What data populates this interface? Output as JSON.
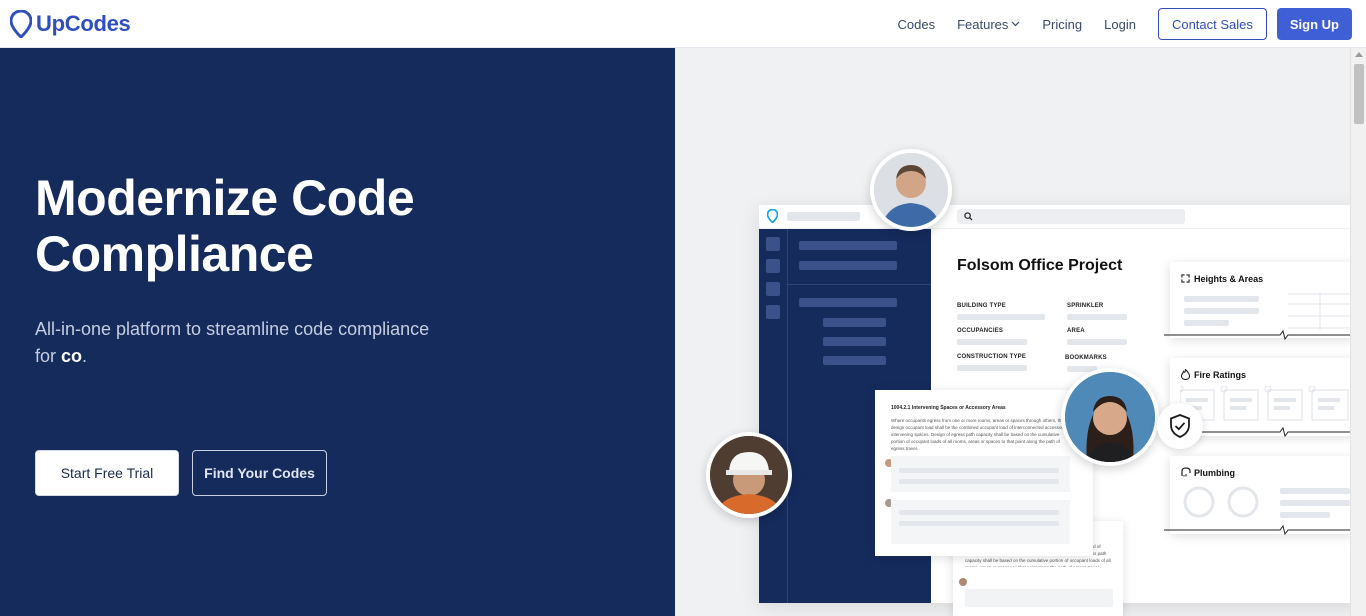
{
  "nav": {
    "brand": "UpCodes",
    "links": [
      "Codes",
      "Features",
      "Pricing",
      "Login"
    ],
    "contact_sales": "Contact Sales",
    "sign_up": "Sign Up"
  },
  "hero": {
    "title": "Modernize Code Compliance",
    "subtitle_pre": "All-in-one platform to streamline code compliance for ",
    "subtitle_emph": "co",
    "subtitle_post": ".",
    "primary_cta": "Start Free Trial",
    "secondary_cta": "Find Your Codes"
  },
  "mockup": {
    "project_title": "Folsom Office Project",
    "field_labels": [
      "BUILDING TYPE",
      "SPRINKLER",
      "OCCUPANCIES",
      "AREA",
      "CONSTRUCTION TYPE",
      "BOOKMARKS"
    ],
    "code_section_title": "1004.2.1 Intervening Spaces or Accessory Areas",
    "code_section_text": "Where occupants egress from one or more rooms, areas or spaces through others, the design occupant load shall be the combined occupant load of interconnected accessory or intervening spaces. Design of egress path capacity shall be based on the cumulative portion of occupant loads of all rooms, areas or spaces to that point along the path of egress travel.",
    "code_fragment_text": "..., the design occupant load shall be the combined occupant load of interconnected accessory or intervening spaces. Design of egress path capacity shall be based on the cumulative portion of occupant loads of all rooms, areas or spaces to that point along the path of egress travel.",
    "side_cards": [
      "Heights & Areas",
      "Fire Ratings",
      "Plumbing"
    ]
  },
  "colors": {
    "brand": "#2f4fbf",
    "hero_bg": "#152b5c",
    "signup_bg": "#3f5fd6"
  }
}
